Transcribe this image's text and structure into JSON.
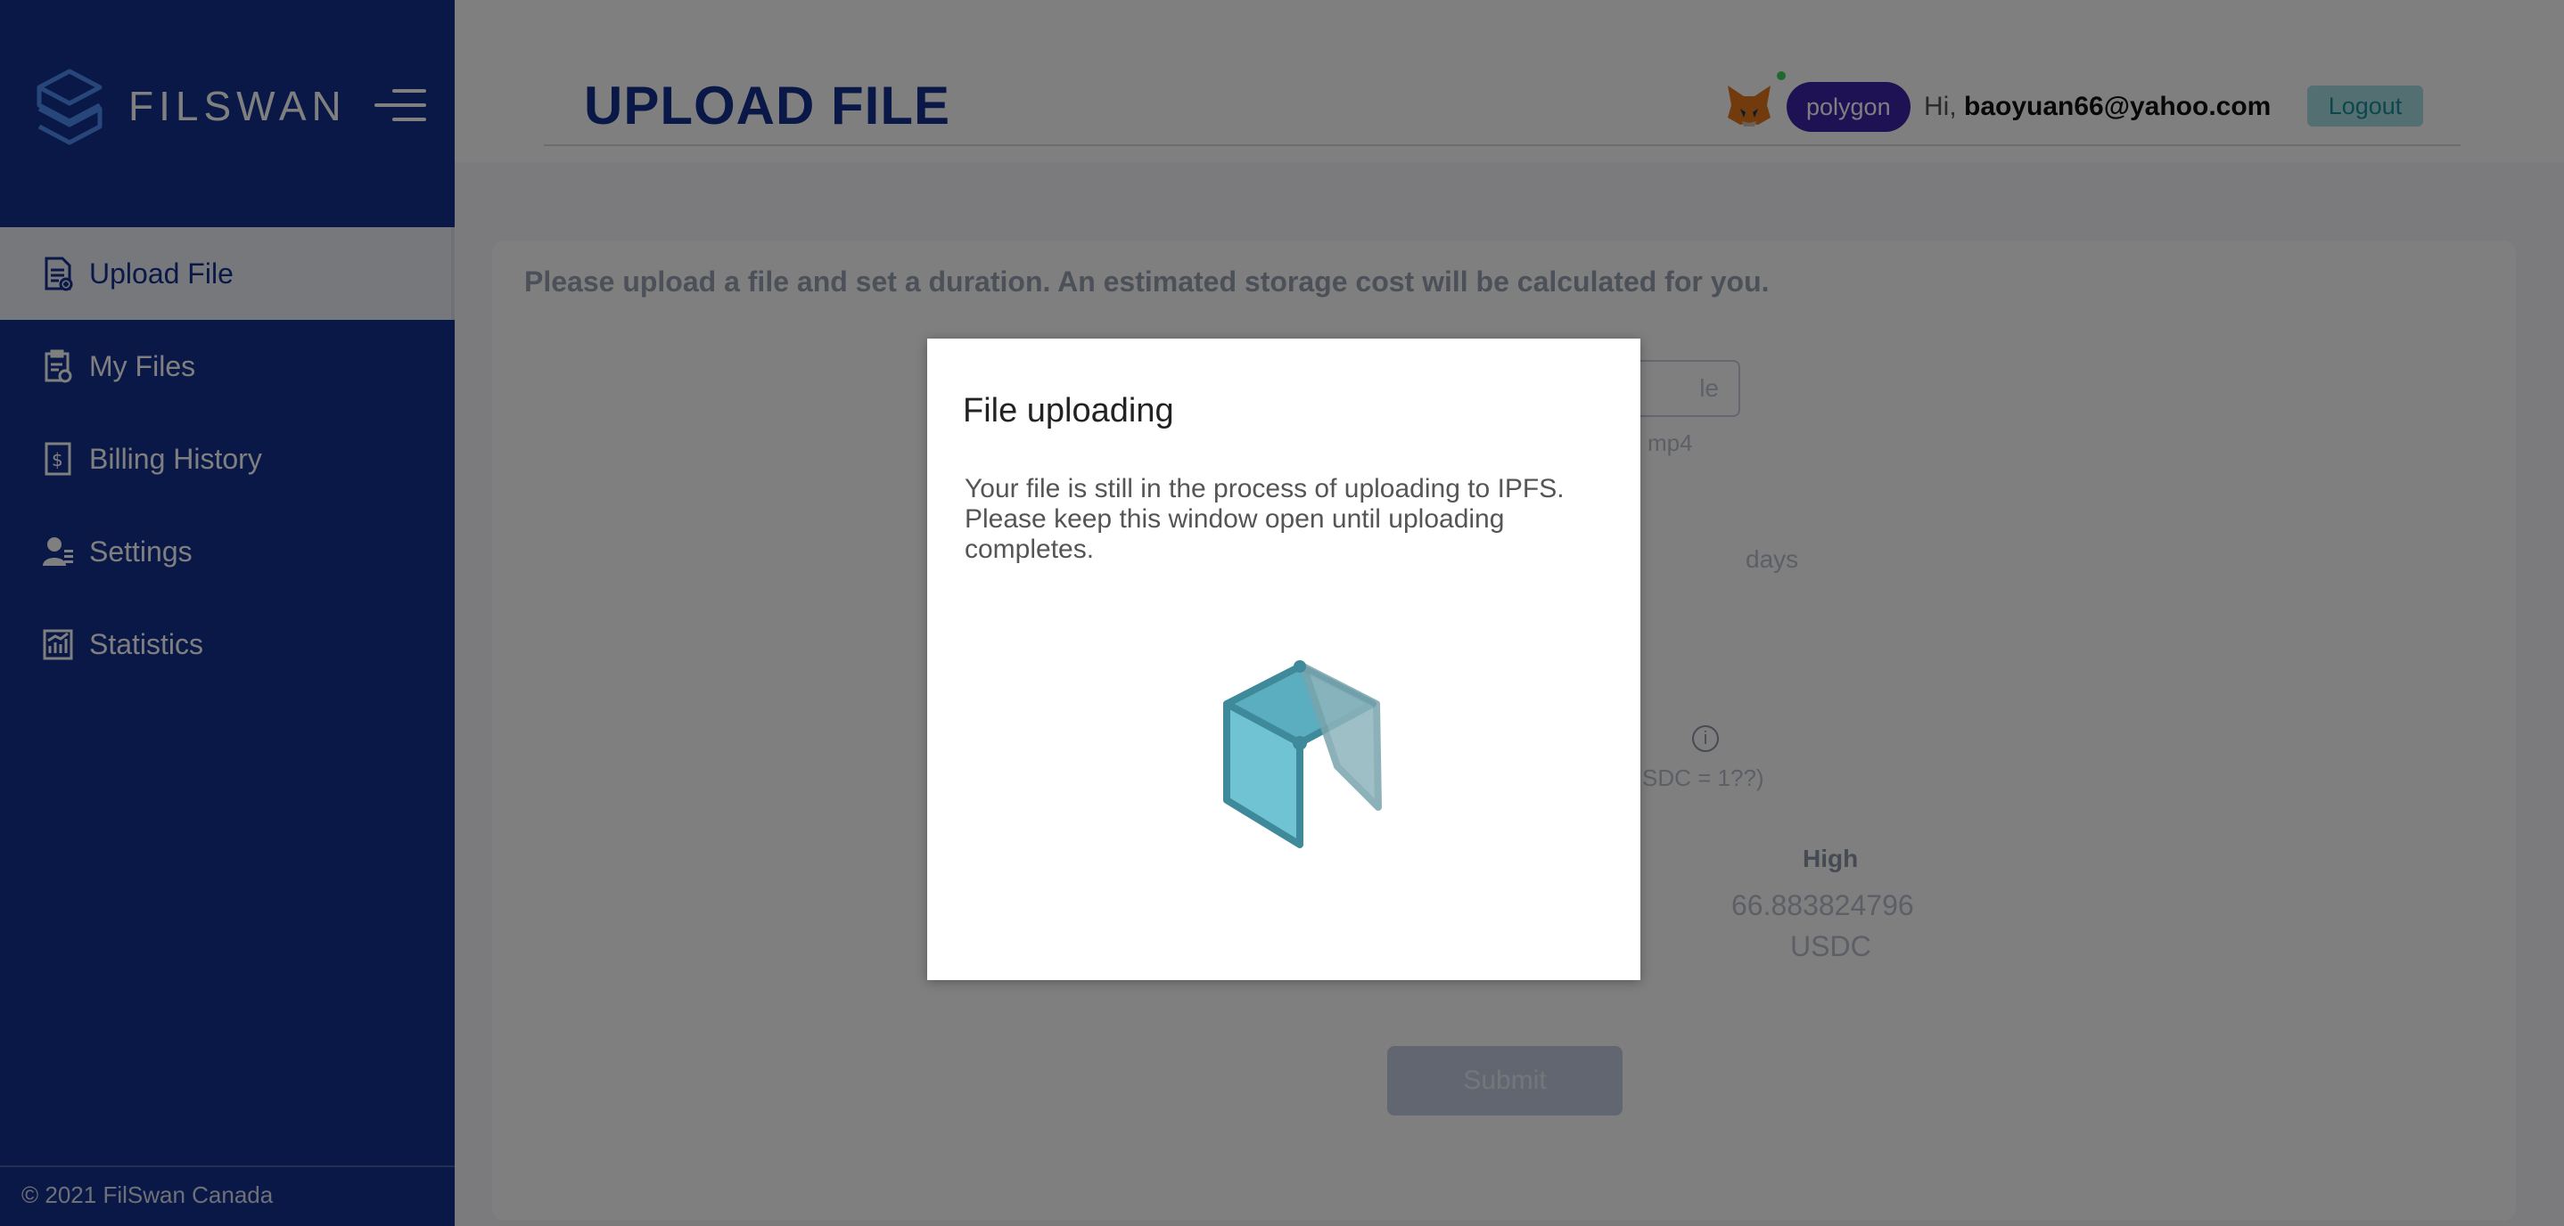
{
  "sidebar": {
    "logo_text": "FILSWAN",
    "items": [
      {
        "label": "Upload File",
        "icon": "upload-file-icon"
      },
      {
        "label": "My Files",
        "icon": "my-files-icon"
      },
      {
        "label": "Billing History",
        "icon": "billing-history-icon"
      },
      {
        "label": "Settings",
        "icon": "settings-icon"
      },
      {
        "label": "Statistics",
        "icon": "statistics-icon"
      }
    ],
    "footer": "© 2021 FilSwan Canada"
  },
  "header": {
    "title": "UPLOAD FILE",
    "network": "polygon",
    "greeting_prefix": "Hi, ",
    "user_email": "baoyuan66@yahoo.com",
    "logout_label": "Logout"
  },
  "form": {
    "intro": "Please upload a file and set a duration. An estimated storage cost will be calculated for you.",
    "choose_file_label": "le",
    "file_hint": "mp4",
    "days_label": "days",
    "usdc_note": "SDC = 1??)",
    "high_label": "High",
    "high_value": "66.883824796",
    "high_unit": "USDC",
    "submit_label": "Submit"
  },
  "modal": {
    "title": "File uploading",
    "body": "Your file is still in the process of uploading to IPFS. Please keep this window open until uploading completes."
  },
  "colors": {
    "sidebar_bg": "#14308f",
    "accent": "#14308f",
    "network_pill": "#3c22a8",
    "logout_bg": "#a8dfe4",
    "cube": "#5aaebf"
  }
}
